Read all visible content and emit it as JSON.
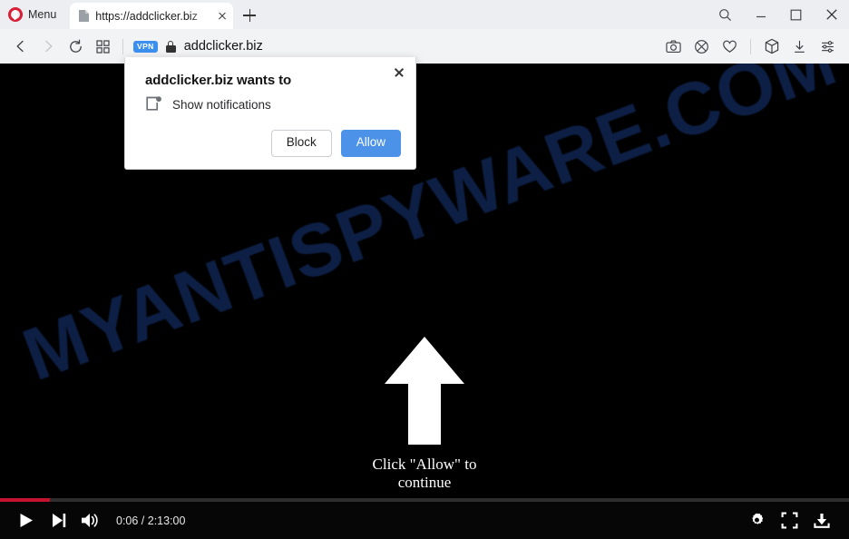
{
  "browser": {
    "menu_label": "Menu",
    "tab": {
      "favicon": "page-icon",
      "title": "https://addclicker.biz",
      "close_icon": "close-icon"
    },
    "new_tab_icon": "plus-icon",
    "window_controls": [
      {
        "name": "search-icon",
        "label": ""
      },
      {
        "name": "minimize-icon",
        "label": ""
      },
      {
        "name": "maximize-icon",
        "label": ""
      },
      {
        "name": "close-window-icon",
        "label": ""
      }
    ],
    "nav": {
      "back_icon": "back-arrow-icon",
      "forward_icon": "forward-arrow-icon",
      "reload_icon": "reload-icon",
      "speeddial_icon": "grid-icon"
    },
    "address": {
      "vpn_badge": "VPN",
      "lock_icon": "lock-icon",
      "url": "addclicker.biz"
    },
    "toolbar_right": [
      {
        "name": "snapshot-icon"
      },
      {
        "name": "ad-blocker-shield-icon"
      },
      {
        "name": "heart-favorites-icon"
      },
      {
        "name": "extensions-cube-icon"
      },
      {
        "name": "downloads-icon"
      },
      {
        "name": "easy-setup-icon"
      }
    ]
  },
  "permission_dialog": {
    "title": "addclicker.biz wants to",
    "permission_icon": "show-notifications-icon",
    "permission_label": "Show notifications",
    "block_label": "Block",
    "allow_label": "Allow",
    "close_icon": "close-icon",
    "allow_color": "#4b92e8"
  },
  "page": {
    "watermark": "MYANTISPYWARE.COM",
    "watermark_color": "#0d1f44",
    "arrow_icon": "up-arrow-icon",
    "cta_line1": "Click \"Allow\" to",
    "cta_line2": "continue"
  },
  "player": {
    "progress_percent": 5.9,
    "progress_color": "#c4122f",
    "play_icon": "play-icon",
    "next_icon": "next-track-icon",
    "volume_icon": "volume-icon",
    "time": "0:06 / 2:13:00",
    "current_time": "0:06",
    "duration": "2:13:00",
    "settings_icon": "gear-icon",
    "fullscreen_icon": "fullscreen-icon",
    "download_icon": "download-icon"
  }
}
